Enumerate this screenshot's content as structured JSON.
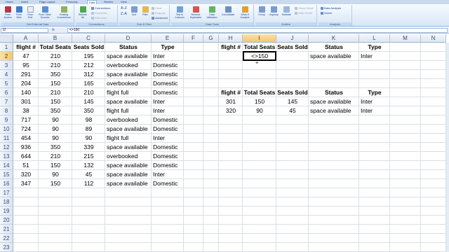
{
  "ribbon": {
    "tabs": [
      "Home",
      "Insert",
      "Page Layout",
      "Formulas",
      "Data",
      "Review",
      "View"
    ],
    "active_tab": "Data",
    "groups": [
      {
        "label": "Get External Data",
        "buttons": [
          "From Access",
          "From Web",
          "From Text",
          "From Other Sources",
          "Existing Connections"
        ]
      },
      {
        "label": "Connections",
        "buttons": [
          "Refresh All",
          "Connections",
          "Properties",
          "Edit Links"
        ]
      },
      {
        "label": "Sort & Filter",
        "buttons": [
          "Sort",
          "Filter",
          "Clear",
          "Reapply",
          "Advanced"
        ]
      },
      {
        "label": "Data Tools",
        "buttons": [
          "Text to Columns",
          "Remove Duplicates",
          "Data Validation",
          "Consolidate",
          "What-If Analysis"
        ]
      },
      {
        "label": "Outline",
        "buttons": [
          "Group",
          "Ungroup",
          "Subtotal",
          "Show Detail",
          "Hide Detail"
        ]
      },
      {
        "label": "Analysis",
        "buttons": [
          "Data Analysis",
          "Solver"
        ]
      }
    ]
  },
  "formula_bar": {
    "name_box": "I2",
    "fx": "fx",
    "content": "<>150"
  },
  "columns": [
    "A",
    "B",
    "C",
    "D",
    "E",
    "F",
    "G",
    "H",
    "I",
    "J",
    "K",
    "L",
    "M",
    "N"
  ],
  "selected_column": "I",
  "rows": [
    "1",
    "2",
    "3",
    "4",
    "5",
    "6",
    "7",
    "8",
    "9",
    "10",
    "11",
    "12",
    "13",
    "14",
    "15",
    "16",
    "17",
    "18",
    "19",
    "20",
    "21",
    "22",
    "23"
  ],
  "selected_row": "2",
  "table": {
    "headers": [
      "flight #",
      "Total Seats",
      "Seats Sold",
      "Status",
      "Type"
    ],
    "rows": [
      [
        "47",
        "210",
        "195",
        "space available",
        "Inter"
      ],
      [
        "95",
        "210",
        "212",
        "overbooked",
        "Domestic"
      ],
      [
        "291",
        "350",
        "312",
        "space available",
        "Domestic"
      ],
      [
        "204",
        "150",
        "165",
        "overbooked",
        "Domestic"
      ],
      [
        "140",
        "210",
        "210",
        "flight full",
        "Domestic"
      ],
      [
        "301",
        "150",
        "145",
        "space available",
        "Inter"
      ],
      [
        "38",
        "350",
        "350",
        "flight full",
        "Inter"
      ],
      [
        "717",
        "90",
        "98",
        "overbooked",
        "Domestic"
      ],
      [
        "724",
        "90",
        "89",
        "space available",
        "Domestic"
      ],
      [
        "454",
        "90",
        "90",
        "flight full",
        "Inter"
      ],
      [
        "936",
        "350",
        "339",
        "space available",
        "Domestic"
      ],
      [
        "644",
        "210",
        "215",
        "overbooked",
        "Domestic"
      ],
      [
        "51",
        "150",
        "132",
        "space available",
        "Domestic"
      ],
      [
        "320",
        "90",
        "45",
        "space available",
        "Inter"
      ],
      [
        "347",
        "150",
        "112",
        "space available",
        "Domestic"
      ]
    ]
  },
  "criteria": {
    "headers": [
      "flight #",
      "Total Seats",
      "Seats Sold",
      "Status",
      "Type"
    ],
    "values": [
      "",
      "<>150",
      "",
      "space available",
      "Inter"
    ]
  },
  "output": {
    "headers": [
      "flight #",
      "Total Seats",
      "Seats Sold",
      "Status",
      "Type"
    ],
    "rows": [
      [
        "301",
        "150",
        "145",
        "space available",
        "Inter"
      ],
      [
        "320",
        "90",
        "45",
        "space available",
        "Inter"
      ]
    ]
  }
}
